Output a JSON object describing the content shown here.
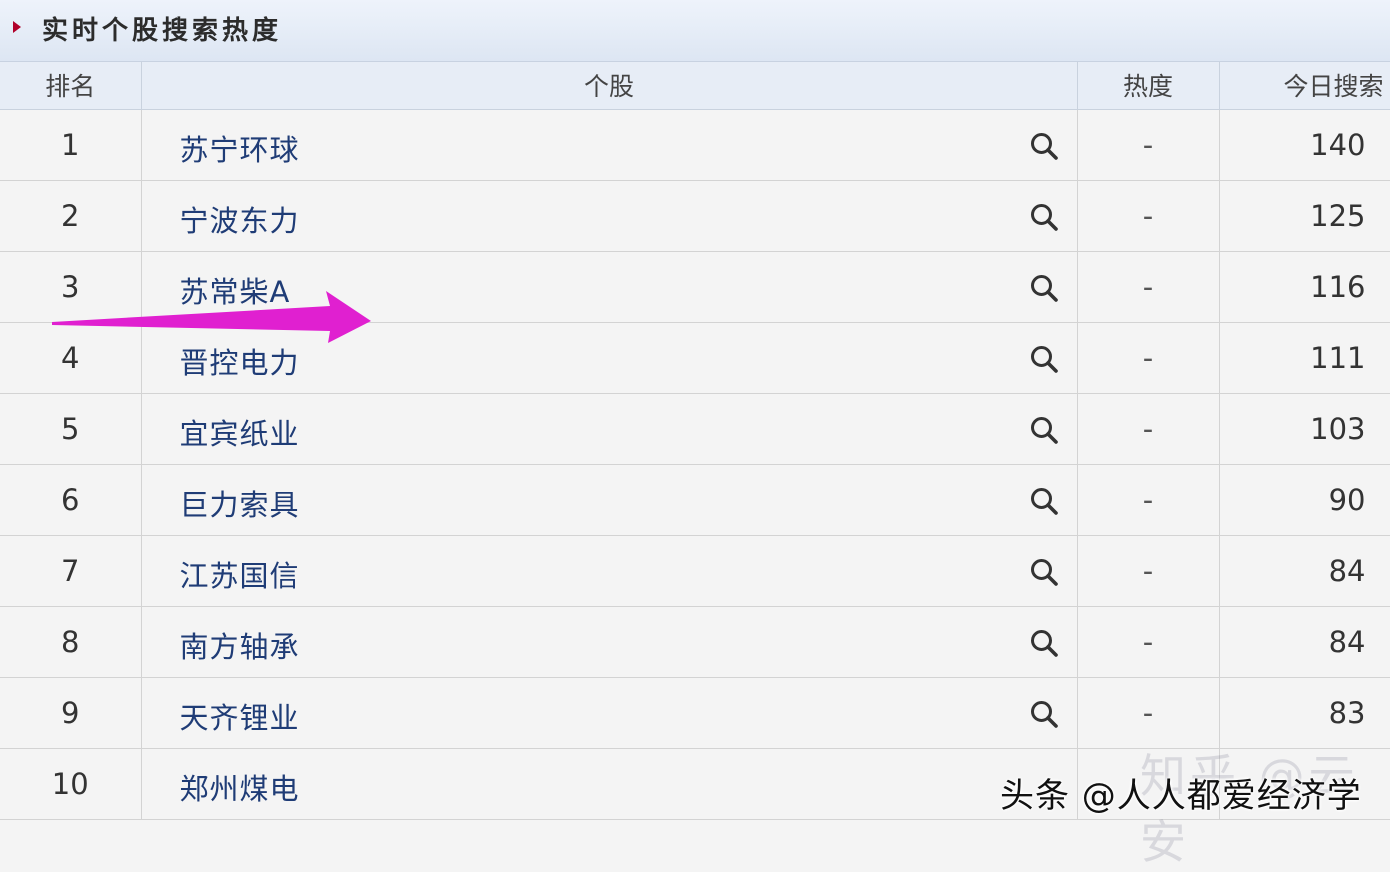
{
  "panel": {
    "title": "实时个股搜索热度",
    "accent": "#b0002a"
  },
  "table": {
    "columns": {
      "rank": "排名",
      "stock": "个股",
      "heat": "热度",
      "today": "今日搜索"
    },
    "rows": [
      {
        "rank": "1",
        "stock": "苏宁环球",
        "heat": "-",
        "today": "140"
      },
      {
        "rank": "2",
        "stock": "宁波东力",
        "heat": "-",
        "today": "125"
      },
      {
        "rank": "3",
        "stock": "苏常柴A",
        "heat": "-",
        "today": "116"
      },
      {
        "rank": "4",
        "stock": "晋控电力",
        "heat": "-",
        "today": "111"
      },
      {
        "rank": "5",
        "stock": "宜宾纸业",
        "heat": "-",
        "today": "103"
      },
      {
        "rank": "6",
        "stock": "巨力索具",
        "heat": "-",
        "today": "90"
      },
      {
        "rank": "7",
        "stock": "江苏国信",
        "heat": "-",
        "today": "84"
      },
      {
        "rank": "8",
        "stock": "南方轴承",
        "heat": "-",
        "today": "84"
      },
      {
        "rank": "9",
        "stock": "天齐锂业",
        "heat": "-",
        "today": "83"
      },
      {
        "rank": "10",
        "stock": "郑州煤电",
        "heat": "",
        "today": ""
      }
    ],
    "search_icon": "search-icon",
    "stock_color": "#1f3c76"
  },
  "annotation": {
    "arrow_color": "#e020d0"
  },
  "watermarks": {
    "zhihu": "知乎 @云安",
    "toutiao": "头条 @人人都爱经济学"
  }
}
